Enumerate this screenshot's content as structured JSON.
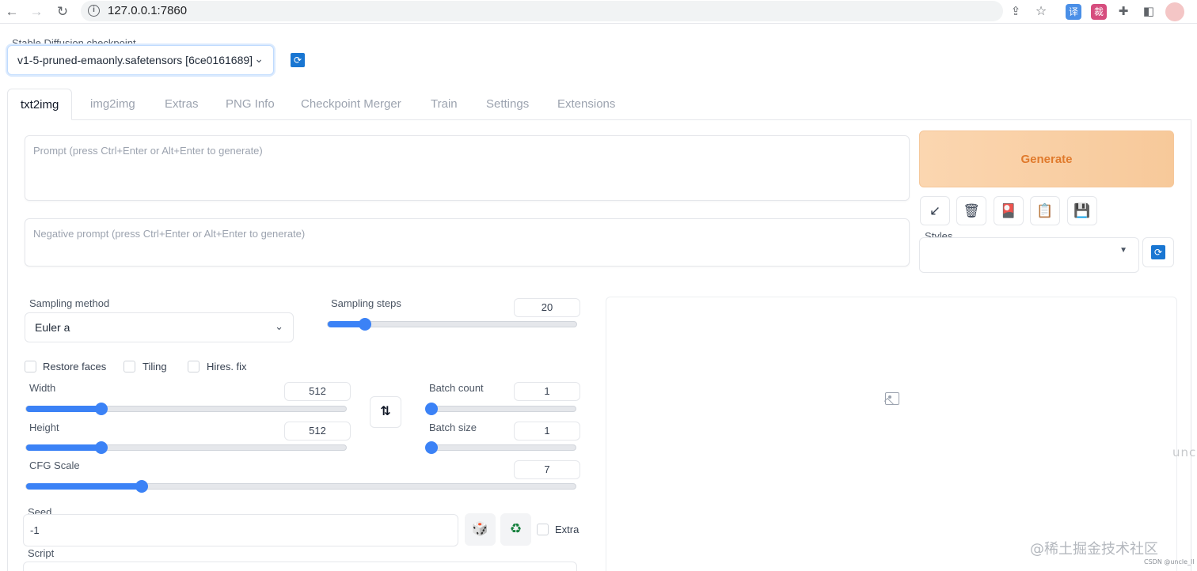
{
  "browser": {
    "url": "127.0.0.1:7860",
    "ext_translate": "译",
    "ext_cut": "裁"
  },
  "checkpoint": {
    "label": "Stable Diffusion checkpoint",
    "value": "v1-5-pruned-emaonly.safetensors [6ce0161689]"
  },
  "tabs": [
    "txt2img",
    "img2img",
    "Extras",
    "PNG Info",
    "Checkpoint Merger",
    "Train",
    "Settings",
    "Extensions"
  ],
  "prompt": {
    "placeholder": "Prompt (press Ctrl+Enter or Alt+Enter to generate)"
  },
  "negative_prompt": {
    "placeholder": "Negative prompt (press Ctrl+Enter or Alt+Enter to generate)"
  },
  "generate_label": "Generate",
  "tool_icons": [
    "↙",
    "🗑",
    "🎴",
    "📋",
    "💾"
  ],
  "styles": {
    "label": "Styles",
    "value": ""
  },
  "sampling_method": {
    "label": "Sampling method",
    "value": "Euler a"
  },
  "sampling_steps": {
    "label": "Sampling steps",
    "value": "20",
    "fraction": 0.15
  },
  "checkboxes": {
    "restore_faces": "Restore faces",
    "tiling": "Tiling",
    "hires_fix": "Hires. fix"
  },
  "width": {
    "label": "Width",
    "value": "512",
    "fraction": 0.235
  },
  "height": {
    "label": "Height",
    "value": "512",
    "fraction": 0.235
  },
  "batch_count": {
    "label": "Batch count",
    "value": "1",
    "fraction": 0
  },
  "batch_size": {
    "label": "Batch size",
    "value": "1",
    "fraction": 0
  },
  "cfg_scale": {
    "label": "CFG Scale",
    "value": "7",
    "fraction": 0.21
  },
  "swap_icon": "⇅",
  "seed": {
    "label": "Seed",
    "value": "-1",
    "extra_label": "Extra",
    "dice_icon": "🎲",
    "recycle_icon": "♻"
  },
  "script": {
    "label": "Script"
  },
  "watermarks": {
    "side": "unc",
    "site": "@稀土掘金技术社区",
    "csdn": "CSDN @uncle_ll"
  },
  "colors": {
    "accent": "#3b82f6",
    "generate": "#f7c99a",
    "generate_text": "#e07a2c"
  }
}
